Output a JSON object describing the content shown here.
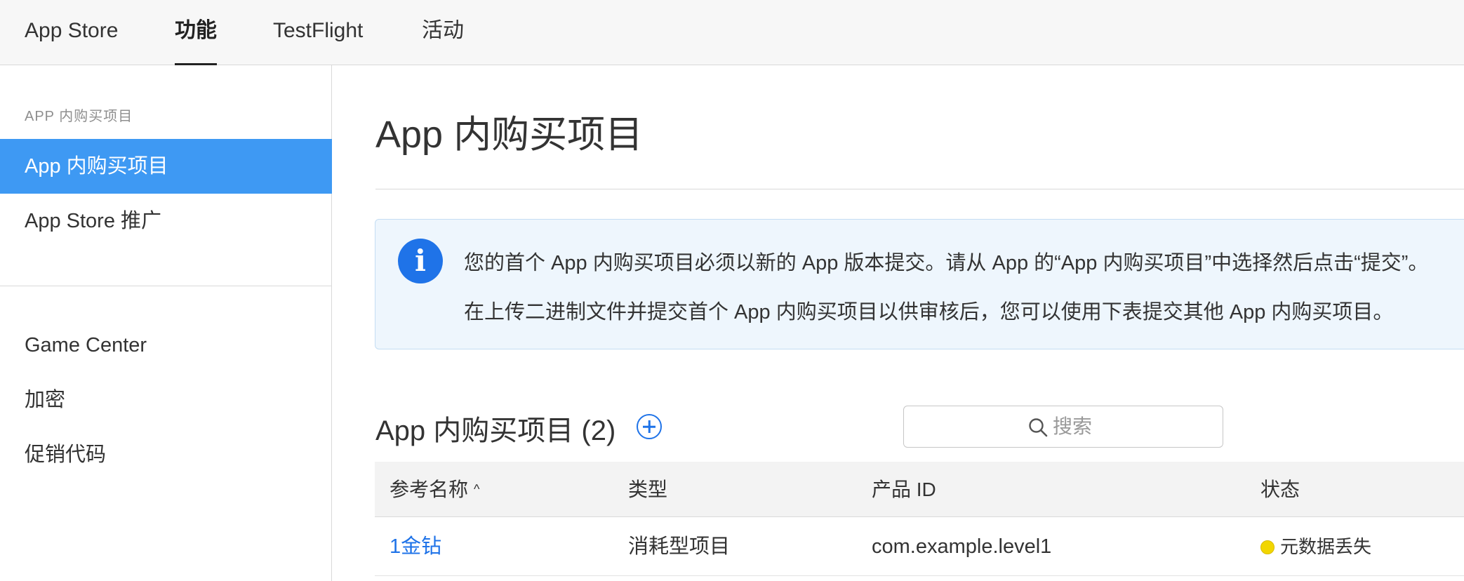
{
  "topnav": {
    "tabs": [
      {
        "label": "App Store",
        "active": false
      },
      {
        "label": "功能",
        "active": true
      },
      {
        "label": "TestFlight",
        "active": false
      },
      {
        "label": "活动",
        "active": false
      }
    ]
  },
  "sidebar": {
    "section_title": "APP 内购买项目",
    "items": [
      {
        "label": "App 内购买项目",
        "active": true
      },
      {
        "label": "App Store 推广",
        "active": false
      },
      {
        "label": "Game Center",
        "active": false
      },
      {
        "label": "加密",
        "active": false
      },
      {
        "label": "促销代码",
        "active": false
      }
    ]
  },
  "main": {
    "title": "App 内购买项目",
    "notice": {
      "icon": "info-icon",
      "line1": "您的首个 App 内购买项目必须以新的 App 版本提交。请从 App 的“App 内购买项目”中选择然后点击“提交”。",
      "line2": "在上传二进制文件并提交首个 App 内购买项目以供审核后，您可以使用下表提交其他 App 内购买项目。"
    },
    "section_heading": "App 内购买项目 (2)",
    "search": {
      "placeholder": "搜索",
      "value": ""
    },
    "table": {
      "columns": [
        "参考名称",
        "类型",
        "产品 ID",
        "状态"
      ],
      "sort_indicator": "^",
      "rows": [
        {
          "name": "1金钻",
          "type": "消耗型项目",
          "product_id": "com.example.level1",
          "status": "元数据丢失",
          "status_color": "#f2d600"
        }
      ]
    }
  },
  "colors": {
    "accent": "#1f73e8",
    "sidebar_active": "#3e99f3",
    "notice_bg": "#eef6fd",
    "status_warning": "#f2d600"
  }
}
